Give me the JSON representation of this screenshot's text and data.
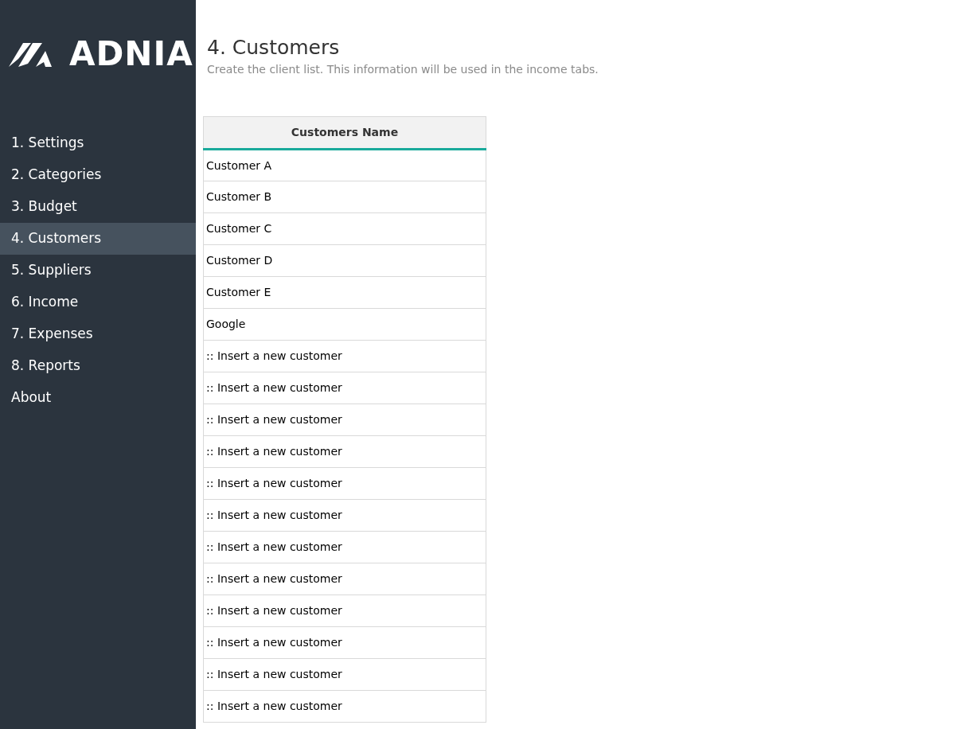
{
  "sidebar": {
    "logo": "ADNIA",
    "items": [
      {
        "label": "1. Settings",
        "selected": false
      },
      {
        "label": "2. Categories",
        "selected": false
      },
      {
        "label": "3. Budget",
        "selected": false
      },
      {
        "label": "4. Customers",
        "selected": true
      },
      {
        "label": "5. Suppliers",
        "selected": false
      },
      {
        "label": "6. Income",
        "selected": false
      },
      {
        "label": "7. Expenses",
        "selected": false
      },
      {
        "label": "8. Reports",
        "selected": false
      },
      {
        "label": "About",
        "selected": false
      }
    ]
  },
  "page": {
    "title": "4. Customers",
    "subtitle": "Create the client list. This information will be used in the income tabs."
  },
  "table": {
    "columns": [
      "Customers Name"
    ],
    "rows": [
      "Customer A",
      "Customer B",
      "Customer C",
      "Customer D",
      "Customer E",
      "Google",
      ":: Insert a new customer",
      ":: Insert a new customer",
      ":: Insert a new customer",
      ":: Insert a new customer",
      ":: Insert a new customer",
      ":: Insert a new customer",
      ":: Insert a new customer",
      ":: Insert a new customer",
      ":: Insert a new customer",
      ":: Insert a new customer",
      ":: Insert a new customer",
      ":: Insert a new customer"
    ]
  }
}
